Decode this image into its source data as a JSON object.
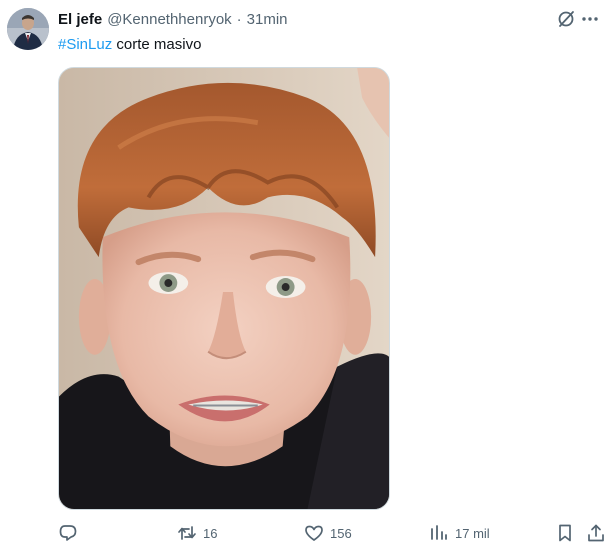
{
  "tweet": {
    "display_name": "El jefe",
    "handle": "@Kennethhenryok",
    "separator": "·",
    "time": "31min",
    "hashtag": "#SinLuz",
    "body": " corte masivo"
  },
  "icons": {
    "more": "grok-slash-icon",
    "reply": "reply-icon",
    "retweet": "retweet-icon",
    "like": "heart-icon",
    "views": "analytics-icon",
    "bookmark": "bookmark-icon",
    "share": "share-icon"
  },
  "actions": {
    "reply_count": "",
    "retweet_count": "16",
    "like_count": "156",
    "views_count": "17 mil"
  },
  "colors": {
    "accent": "#1d9bf0",
    "text_primary": "#0f1419",
    "text_secondary": "#536471"
  }
}
